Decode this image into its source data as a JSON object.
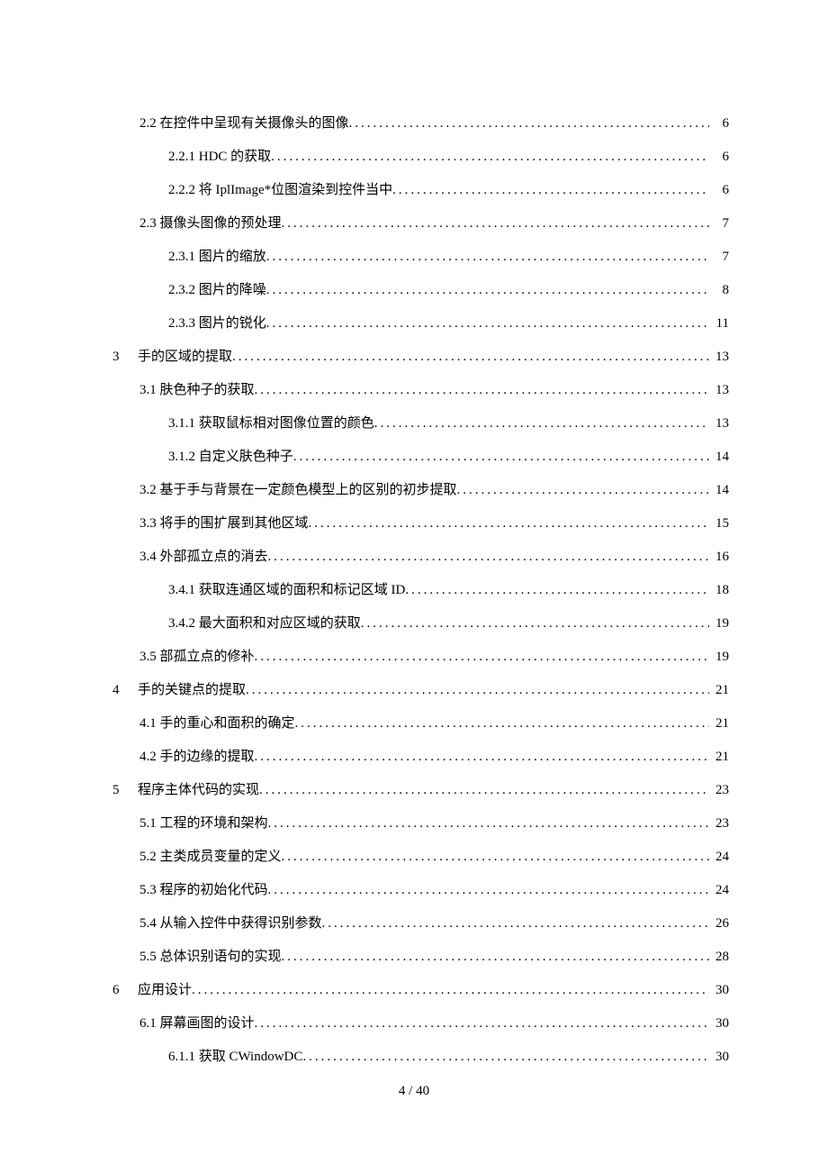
{
  "footer": "4 / 40",
  "toc": [
    {
      "level": 1,
      "num": "",
      "label": "2.2 在控件中呈现有关摄像头的图像",
      "page": "6"
    },
    {
      "level": 2,
      "num": "",
      "label": "2.2.1 HDC 的获取",
      "page": "6"
    },
    {
      "level": 2,
      "num": "",
      "label": "2.2.2 将 IplImage*位图渲染到控件当中",
      "page": "6"
    },
    {
      "level": 1,
      "num": "",
      "label": "2.3 摄像头图像的预处理",
      "page": "7"
    },
    {
      "level": 2,
      "num": "",
      "label": "2.3.1 图片的缩放 ",
      "page": "7"
    },
    {
      "level": 2,
      "num": "",
      "label": "2.3.2 图片的降噪 ",
      "page": "8"
    },
    {
      "level": 2,
      "num": "",
      "label": "2.3.3 图片的锐化 ",
      "page": "11"
    },
    {
      "level": 0,
      "num": "3",
      "label": "手的区域的提取 ",
      "page": "13"
    },
    {
      "level": 1,
      "num": "",
      "label": "3.1 肤色种子的获取",
      "page": "13"
    },
    {
      "level": 2,
      "num": "",
      "label": "3.1.1 获取鼠标相对图像位置的颜色 ",
      "page": "13"
    },
    {
      "level": 2,
      "num": "",
      "label": "3.1.2 自定义肤色种子 ",
      "page": "14"
    },
    {
      "level": 1,
      "num": "",
      "label": "3.2 基于手与背景在一定颜色模型上的区别的初步提取",
      "page": "14"
    },
    {
      "level": 1,
      "num": "",
      "label": "3.3 将手的围扩展到其他区域",
      "page": "15"
    },
    {
      "level": 1,
      "num": "",
      "label": "3.4 外部孤立点的消去",
      "page": "16"
    },
    {
      "level": 2,
      "num": "",
      "label": "3.4.1 获取连通区域的面积和标记区域 ID",
      "page": "18"
    },
    {
      "level": 2,
      "num": "",
      "label": "3.4.2 最大面积和对应区域的获取 ",
      "page": "19"
    },
    {
      "level": 1,
      "num": "",
      "label": "3.5 部孤立点的修补",
      "page": "19"
    },
    {
      "level": 0,
      "num": "4",
      "label": "手的关键点的提取 ",
      "page": "21"
    },
    {
      "level": 1,
      "num": "",
      "label": "4.1 手的重心和面积的确定",
      "page": "21"
    },
    {
      "level": 1,
      "num": "",
      "label": "4.2 手的边缘的提取",
      "page": "21"
    },
    {
      "level": 0,
      "num": "5",
      "label": "程序主体代码的实现 ",
      "page": "23"
    },
    {
      "level": 1,
      "num": "",
      "label": "5.1 工程的环境和架构",
      "page": "23"
    },
    {
      "level": 1,
      "num": "",
      "label": "5.2 主类成员变量的定义",
      "page": "24"
    },
    {
      "level": 1,
      "num": "",
      "label": "5.3 程序的初始化代码",
      "page": "24"
    },
    {
      "level": 1,
      "num": "",
      "label": "5.4 从输入控件中获得识别参数",
      "page": "26"
    },
    {
      "level": 1,
      "num": "",
      "label": "5.5 总体识别语句的实现",
      "page": "28"
    },
    {
      "level": 0,
      "num": "6",
      "label": "应用设计 ",
      "page": "30"
    },
    {
      "level": 1,
      "num": "",
      "label": "6.1 屏幕画图的设计",
      "page": "30"
    },
    {
      "level": 2,
      "num": "",
      "label": "6.1.1 获取 CWindowDC",
      "page": "30"
    }
  ]
}
